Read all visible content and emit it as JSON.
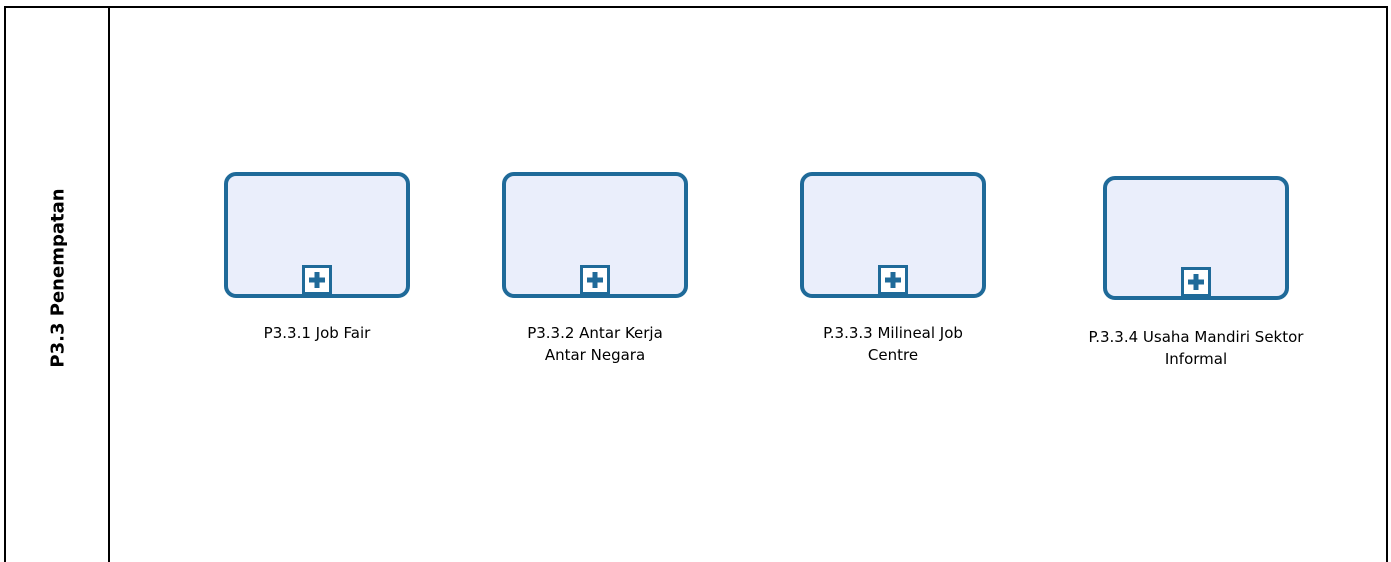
{
  "lane": {
    "title": "P3.3 Penempatan"
  },
  "tasks": [
    {
      "label": "P3.3.1 Job Fair",
      "marker_icon": "plus-icon"
    },
    {
      "label": "P3.3.2 Antar Kerja Antar Negara",
      "marker_icon": "plus-icon"
    },
    {
      "label": "P.3.3.3 Milineal Job Centre",
      "marker_icon": "plus-icon"
    },
    {
      "label": "P.3.3.4 Usaha Mandiri Sektor Informal",
      "marker_icon": "plus-icon"
    }
  ],
  "colors": {
    "task_fill": "#eaeefb",
    "task_border": "#1f6a99",
    "lane_border": "#000000"
  }
}
